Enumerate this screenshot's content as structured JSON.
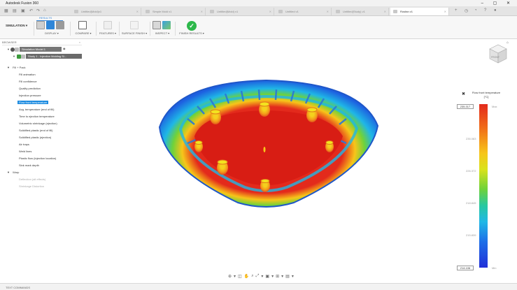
{
  "app": {
    "title": "Autodesk Fusion 360",
    "window_controls": "–  ▢  ✕"
  },
  "tabs": [
    {
      "label": "Untitled(Mold)v1"
    },
    {
      "label": "Simple Mold v1"
    },
    {
      "label": "Untitled(Mold) v1"
    },
    {
      "label": "Untitled v1"
    },
    {
      "label": "Untitled(Study) v1"
    },
    {
      "label": "Rosfan v1",
      "active": true
    }
  ],
  "ribbon": {
    "workspace": "SIMULATION ▾",
    "results_tab": "RESULTS",
    "groups": [
      {
        "label": "DISPLAY ▾"
      },
      {
        "label": "COMPARE ▾"
      },
      {
        "label": "FEATURES ▾"
      },
      {
        "label": "SURFACE FINISH ▾"
      },
      {
        "label": "INSPECT ▾"
      },
      {
        "label": "FINISH RESULTS ▾"
      }
    ]
  },
  "browser": {
    "title": "BROWSER",
    "model": "Simulation Model 1",
    "study": "Study 1 - Injection Molding Si...",
    "fill_pack_header": "Fill + Pack",
    "fill_items": [
      {
        "label": "Fill animation"
      },
      {
        "label": "Fill confidence"
      },
      {
        "label": "Quality prediction"
      },
      {
        "label": "Injection pressure"
      },
      {
        "label": "Flow front temperature",
        "selected": true
      },
      {
        "label": "Avg. temperature (end of fill)"
      },
      {
        "label": "Time to ejection temperature"
      },
      {
        "label": "Volumetric shrinkage (ejection)"
      },
      {
        "label": "Solidified plastic (end of fill)"
      },
      {
        "label": "Solidified plastic (ejection)"
      },
      {
        "label": "Air traps"
      },
      {
        "label": "Weld lines"
      },
      {
        "label": "Plastic flow (injection location)"
      },
      {
        "label": "Sink mark depth"
      }
    ],
    "warp_header": "Warp",
    "warp_items": [
      {
        "label": "Deflection (all effects)"
      },
      {
        "label": "Shrinkage Distortion"
      }
    ]
  },
  "legend": {
    "title": "Flow front temperature",
    "unit_top": "[°C]",
    "max_value": "235.317",
    "min_value": "214.106",
    "ticks": [
      "235.083",
      "226.372",
      "218.845",
      "215.839"
    ],
    "max_tag": "Max",
    "min_tag": "Min"
  },
  "viewcube": {
    "label": "FRONT"
  },
  "statusbar": {
    "label": "TEXT COMMANDS"
  },
  "colors": {
    "hot": "#e32a1c",
    "warm": "#f7c51a",
    "mid": "#6fd23a",
    "cool": "#1fb7e6",
    "cold": "#2230d8",
    "accent": "#1c8be0",
    "finish": "#2db84b"
  }
}
